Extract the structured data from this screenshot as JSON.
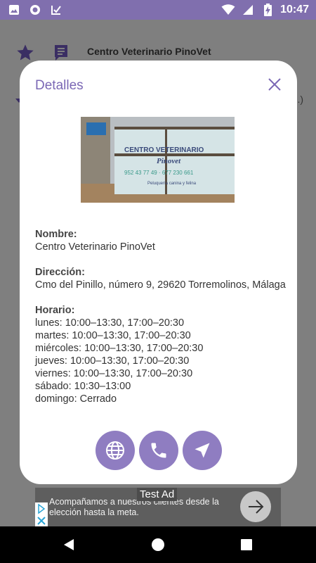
{
  "status_bar": {
    "time": "10:47",
    "left_icons": [
      "gallery-icon",
      "circle-app-icon",
      "download-check-icon"
    ],
    "right_icons": [
      "wifi-icon",
      "signal-icon",
      "battery-charging-icon"
    ]
  },
  "background_page": {
    "title": "Centro Veterinario PinoVet",
    "peek_text": ".)"
  },
  "dialog": {
    "title": "Detalles",
    "image_text": {
      "line1": "CENTRO VETERINARIO",
      "line2": "Pinovet",
      "phones": "952 43 77 49 · 677 230 661",
      "tagline": "Peluquería canina y felina"
    },
    "name_label": "Nombre:",
    "name_value": "Centro Veterinario PinoVet",
    "address_label": "Dirección:",
    "address_value": "Cmo del Pinillo, número 9, 29620 Torremolinos, Málaga",
    "hours_label": "Horario:",
    "hours": [
      "lunes: 10:00–13:30, 17:00–20:30",
      "martes: 10:00–13:30, 17:00–20:30",
      "miércoles: 10:00–13:30, 17:00–20:30",
      "jueves: 10:00–13:30, 17:00–20:30",
      "viernes: 10:00–13:30, 17:00–20:30",
      "sábado: 10:30–13:00",
      "domingo: Cerrado"
    ],
    "actions": [
      "globe-icon",
      "phone-icon",
      "navigation-arrow-icon"
    ]
  },
  "ad": {
    "tag": "Test Ad",
    "text": "Acompañamos a nuestros clientes desde la elección hasta la meta."
  },
  "colors": {
    "accent": "#806fae",
    "button": "#8f7dc1",
    "title": "#7b68b5"
  }
}
